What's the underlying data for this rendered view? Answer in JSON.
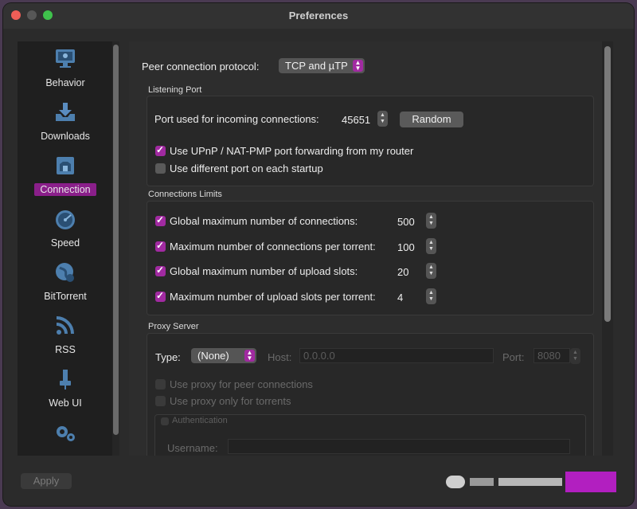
{
  "window": {
    "title": "Preferences"
  },
  "sidebar": {
    "items": [
      {
        "label": "Behavior",
        "icon": "monitor-icon"
      },
      {
        "label": "Downloads",
        "icon": "download-tray-icon"
      },
      {
        "label": "Connection",
        "icon": "network-icon",
        "selected": true
      },
      {
        "label": "Speed",
        "icon": "speedometer-icon"
      },
      {
        "label": "BitTorrent",
        "icon": "globe-icon"
      },
      {
        "label": "RSS",
        "icon": "rss-icon"
      },
      {
        "label": "Web UI",
        "icon": "plug-icon"
      },
      {
        "label": "",
        "icon": "gears-icon"
      }
    ]
  },
  "connection": {
    "protocol_label": "Peer connection protocol:",
    "protocol_value": "TCP and µTP",
    "listening_port": {
      "title": "Listening Port",
      "port_label": "Port used for incoming connections:",
      "port_value": "45651",
      "random_button": "Random",
      "upnp_label": "Use UPnP / NAT-PMP port forwarding from my router",
      "upnp_checked": true,
      "diffport_label": "Use different port on each startup",
      "diffport_checked": false
    },
    "limits": {
      "title": "Connections Limits",
      "rows": [
        {
          "label": "Global maximum number of connections:",
          "value": "500",
          "checked": true
        },
        {
          "label": "Maximum number of connections per torrent:",
          "value": "100",
          "checked": true
        },
        {
          "label": "Global maximum number of upload slots:",
          "value": "20",
          "checked": true
        },
        {
          "label": "Maximum number of upload slots per torrent:",
          "value": "4",
          "checked": true
        }
      ]
    },
    "proxy": {
      "title": "Proxy Server",
      "type_label": "Type:",
      "type_value": "(None)",
      "host_label": "Host:",
      "host_value": "0.0.0.0",
      "port_label": "Port:",
      "port_value": "8080",
      "peer_label": "Use proxy for peer connections",
      "torrents_label": "Use proxy only for torrents",
      "auth_label": "Authentication",
      "username_label": "Username:"
    }
  },
  "footer": {
    "apply_label": "Apply"
  },
  "colors": {
    "accent": "#a12aa1",
    "selected": "#8a1f8a"
  }
}
